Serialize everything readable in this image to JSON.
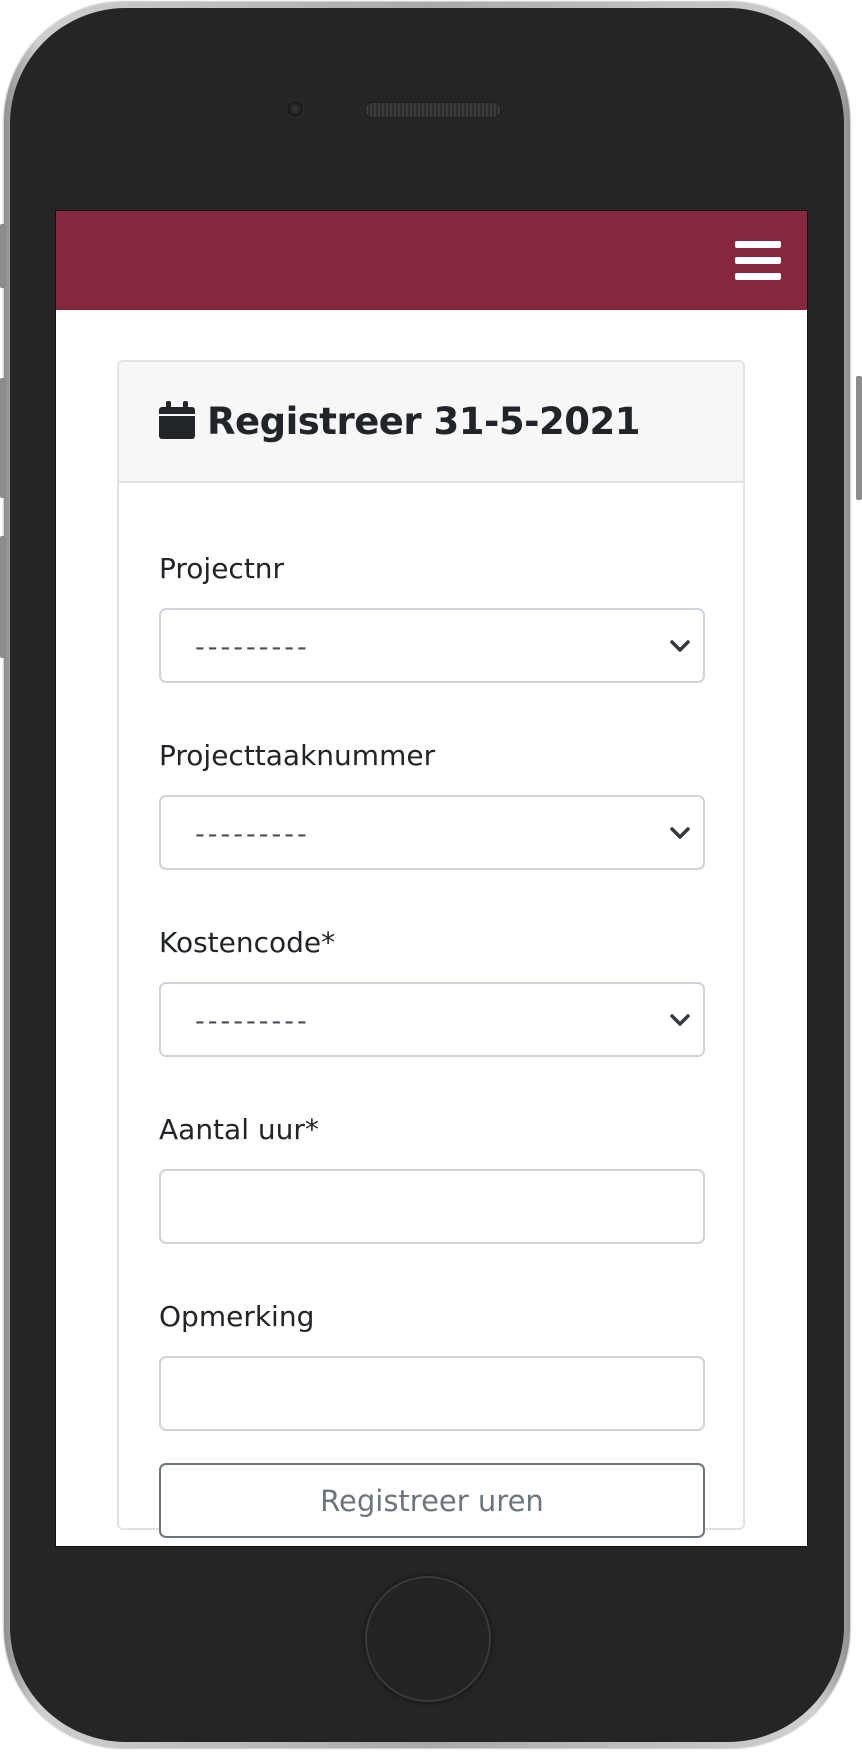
{
  "navbar": {
    "menu_icon": "hamburger-menu-icon",
    "background_color": "#86273e"
  },
  "card": {
    "header_icon": "calendar-icon",
    "title": "Registreer 31-5-2021"
  },
  "form": {
    "projectnr": {
      "label": "Projectnr",
      "value": "---------"
    },
    "projecttaaknummer": {
      "label": "Projecttaaknummer",
      "value": "---------"
    },
    "kostencode": {
      "label": "Kostencode*",
      "value": "---------"
    },
    "aantal_uur": {
      "label": "Aantal uur*",
      "value": ""
    },
    "opmerking": {
      "label": "Opmerking",
      "value": ""
    },
    "submit_label": "Registreer uren"
  }
}
